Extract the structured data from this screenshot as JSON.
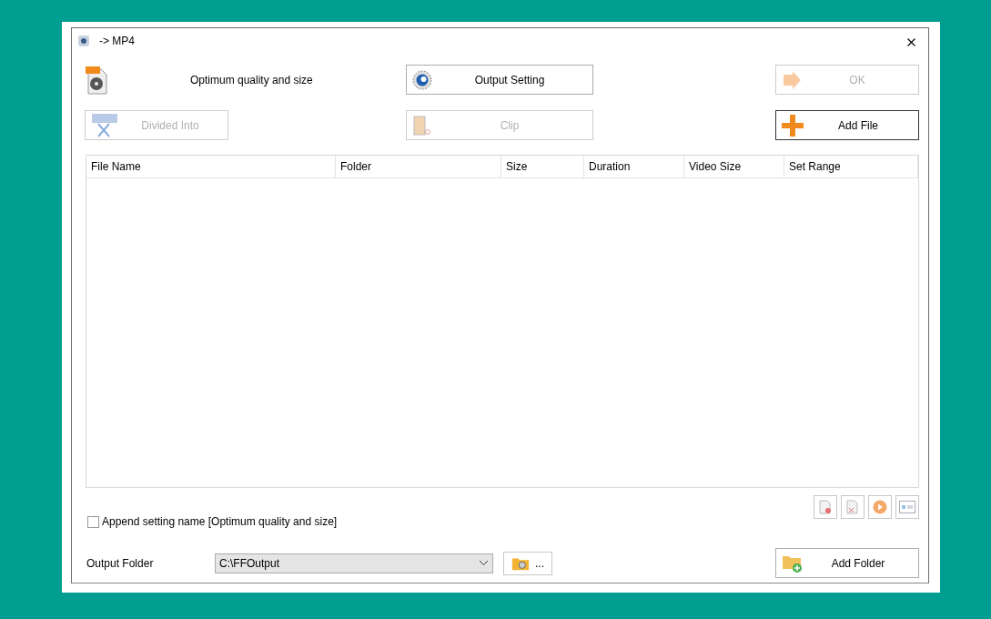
{
  "window": {
    "title": "-> MP4"
  },
  "profile": {
    "label": "Optimum quality and size"
  },
  "buttons": [
    {
      "kind": "setting",
      "label": "Output Setting",
      "disabled": false
    },
    {
      "kind": "ok",
      "label": "OK",
      "disabled": true
    },
    {
      "kind": "divide",
      "label": "Divided Into",
      "disabled": true
    },
    {
      "kind": "clip",
      "label": "Clip",
      "disabled": true
    },
    {
      "kind": "add",
      "label": "Add File",
      "disabled": false
    }
  ],
  "table": {
    "columns": [
      "File Name",
      "Folder",
      "Size",
      "Duration",
      "Video Size",
      "Set Range"
    ]
  },
  "append_setting": {
    "label": "Append setting name [Optimum quality and size]",
    "checked": false
  },
  "output_folder": {
    "label": "Output Folder",
    "value": "C:\\FFOutput",
    "browse": "..."
  },
  "add_folder": {
    "label": "Add Folder",
    "disabled": false
  }
}
